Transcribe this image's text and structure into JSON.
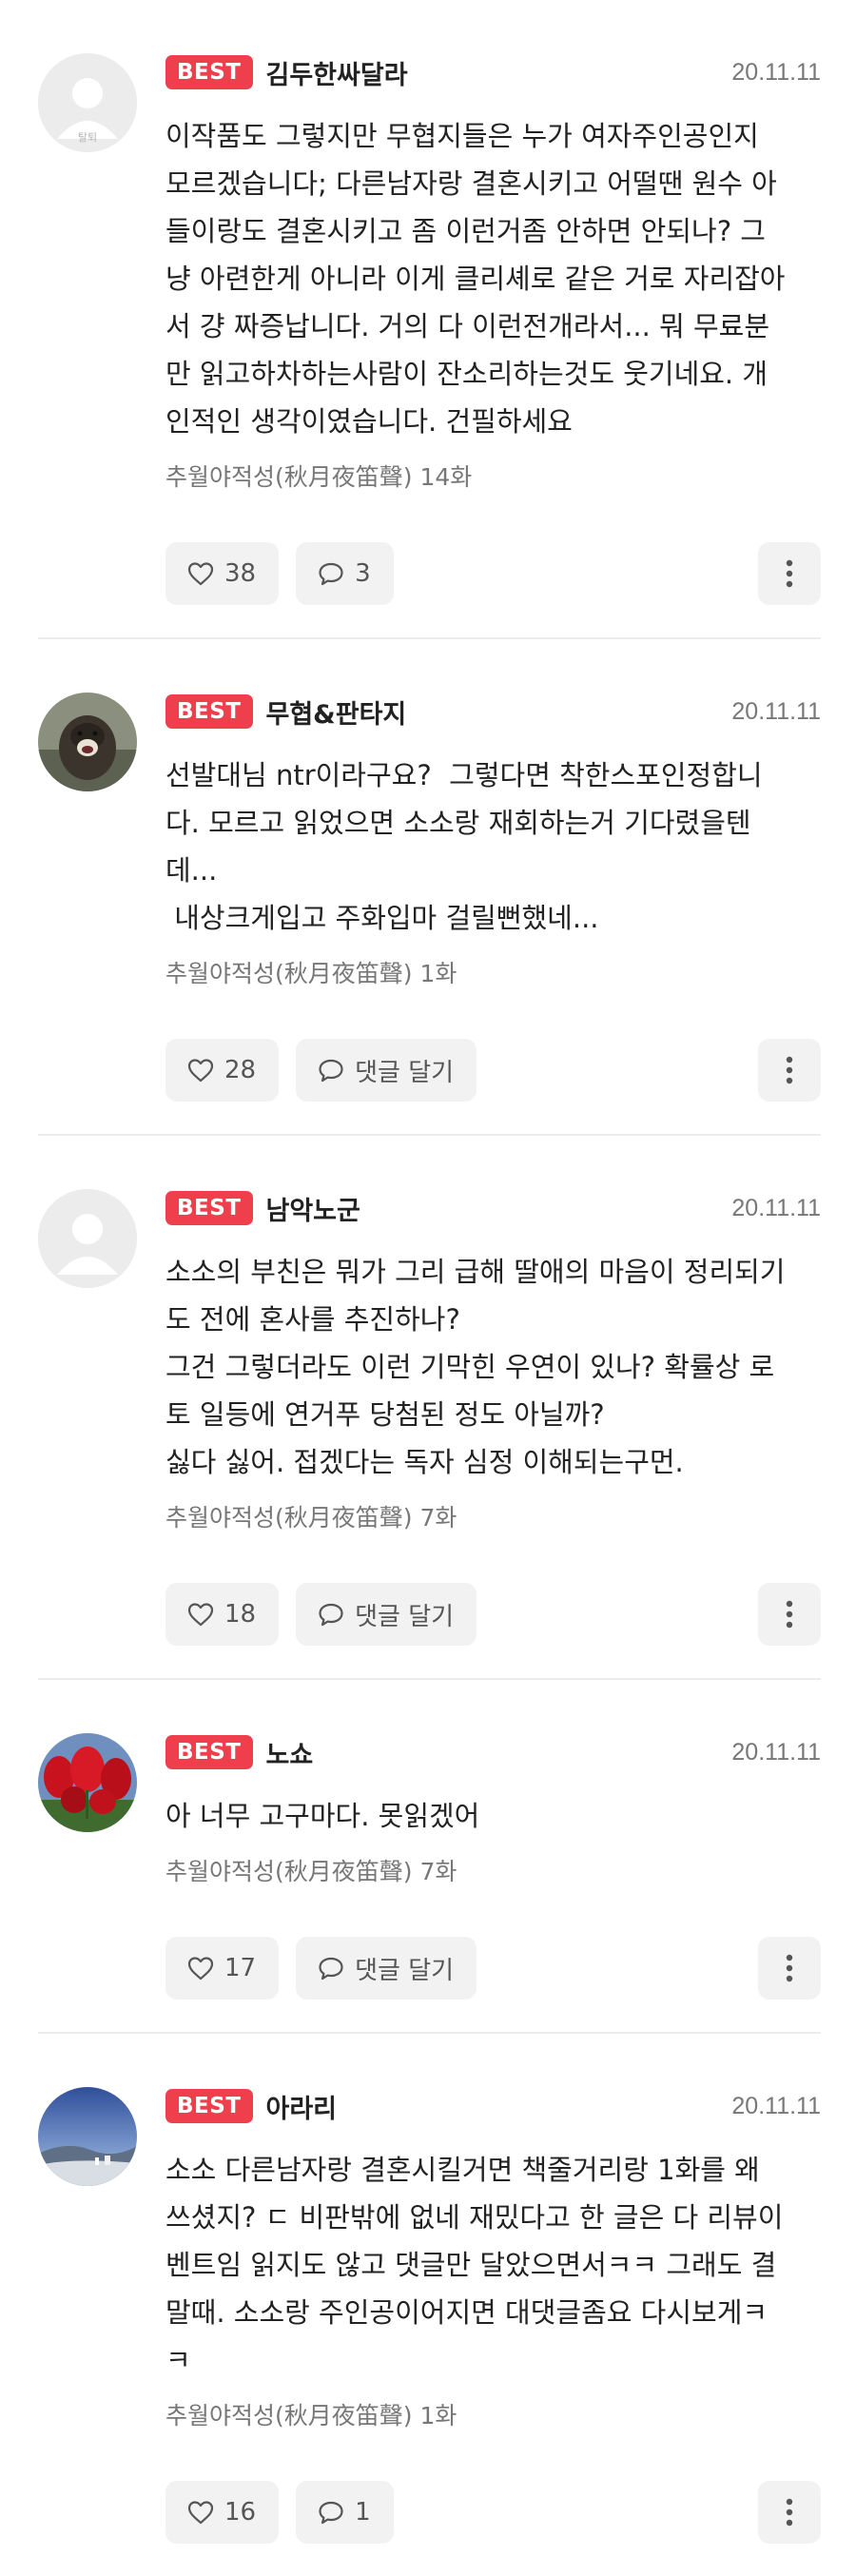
{
  "comments": [
    {
      "best": "BEST",
      "nickname": "김두한싸달라",
      "date": "20.11.11",
      "avatar_caption": "탈퇴",
      "text": "이작품도 그렇지만 무협지들은 누가 여자주인공인지\n모르겠습니다; 다른남자랑 결혼시키고 어떨땐 원수 아\n들이랑도 결혼시키고 좀 이런거좀 안하면 안되나? 그\n냥 아련한게 아니라 이게 클리셰로 같은 거로 자리잡아\n서 걍 짜증납니다. 거의 다 이런전개라서... 뭐 무료분\n만 읽고하차하는사람이 잔소리하는것도 웃기네요. 개\n인적인 생각이였습니다. 건필하세요",
      "source": "추월야적성(秋月夜笛聲) 14화",
      "likes": "38",
      "reply": "3"
    },
    {
      "best": "BEST",
      "nickname": "무협&판타지",
      "date": "20.11.11",
      "text": "선발대님 ntr이라구요?  그렇다면 착한스포인정합니\n다. 모르고 읽었으면 소소랑 재회하는거 기다렸을텐\n데...\n 내상크게입고 주화입마 걸릴뻔했네...",
      "source": "추월야적성(秋月夜笛聲) 1화",
      "likes": "28",
      "reply": "댓글 달기"
    },
    {
      "best": "BEST",
      "nickname": "남악노군",
      "date": "20.11.11",
      "text": "소소의 부친은 뭐가 그리 급해 딸애의 마음이 정리되기\n도 전에 혼사를 추진하나?\n그건 그렇더라도 이런 기막힌 우연이 있나? 확률상 로\n토 일등에 연거푸 당첨된 정도 아닐까?\n싫다 싫어. 접겠다는 독자 심정 이해되는구먼.",
      "source": "추월야적성(秋月夜笛聲) 7화",
      "likes": "18",
      "reply": "댓글 달기"
    },
    {
      "best": "BEST",
      "nickname": "노쇼",
      "date": "20.11.11",
      "text": "아 너무 고구마다. 못읽겠어",
      "source": "추월야적성(秋月夜笛聲) 7화",
      "likes": "17",
      "reply": "댓글 달기"
    },
    {
      "best": "BEST",
      "nickname": "아라리",
      "date": "20.11.11",
      "text": "소소 다른남자랑 결혼시킬거면 책줄거리랑 1화를 왜\n쓰셨지? ㄷ 비판밖에 없네 재밌다고 한 글은 다 리뷰이\n벤트임 읽지도 않고 댓글만 달았으면서ㅋㅋ 그래도 결\n말때. 소소랑 주인공이어지면 대댓글좀요 다시보게ㅋ\nㅋ",
      "source": "추월야적성(秋月夜笛聲) 1화",
      "likes": "16",
      "reply": "1"
    }
  ],
  "icons": {
    "like": "heart-outline-icon",
    "reply": "speech-bubble-icon",
    "more": "vertical-dots-icon"
  },
  "colors": {
    "best_badge": "#ef3e4c",
    "button_bg": "#f2f2f2",
    "meta_text": "#777777"
  }
}
